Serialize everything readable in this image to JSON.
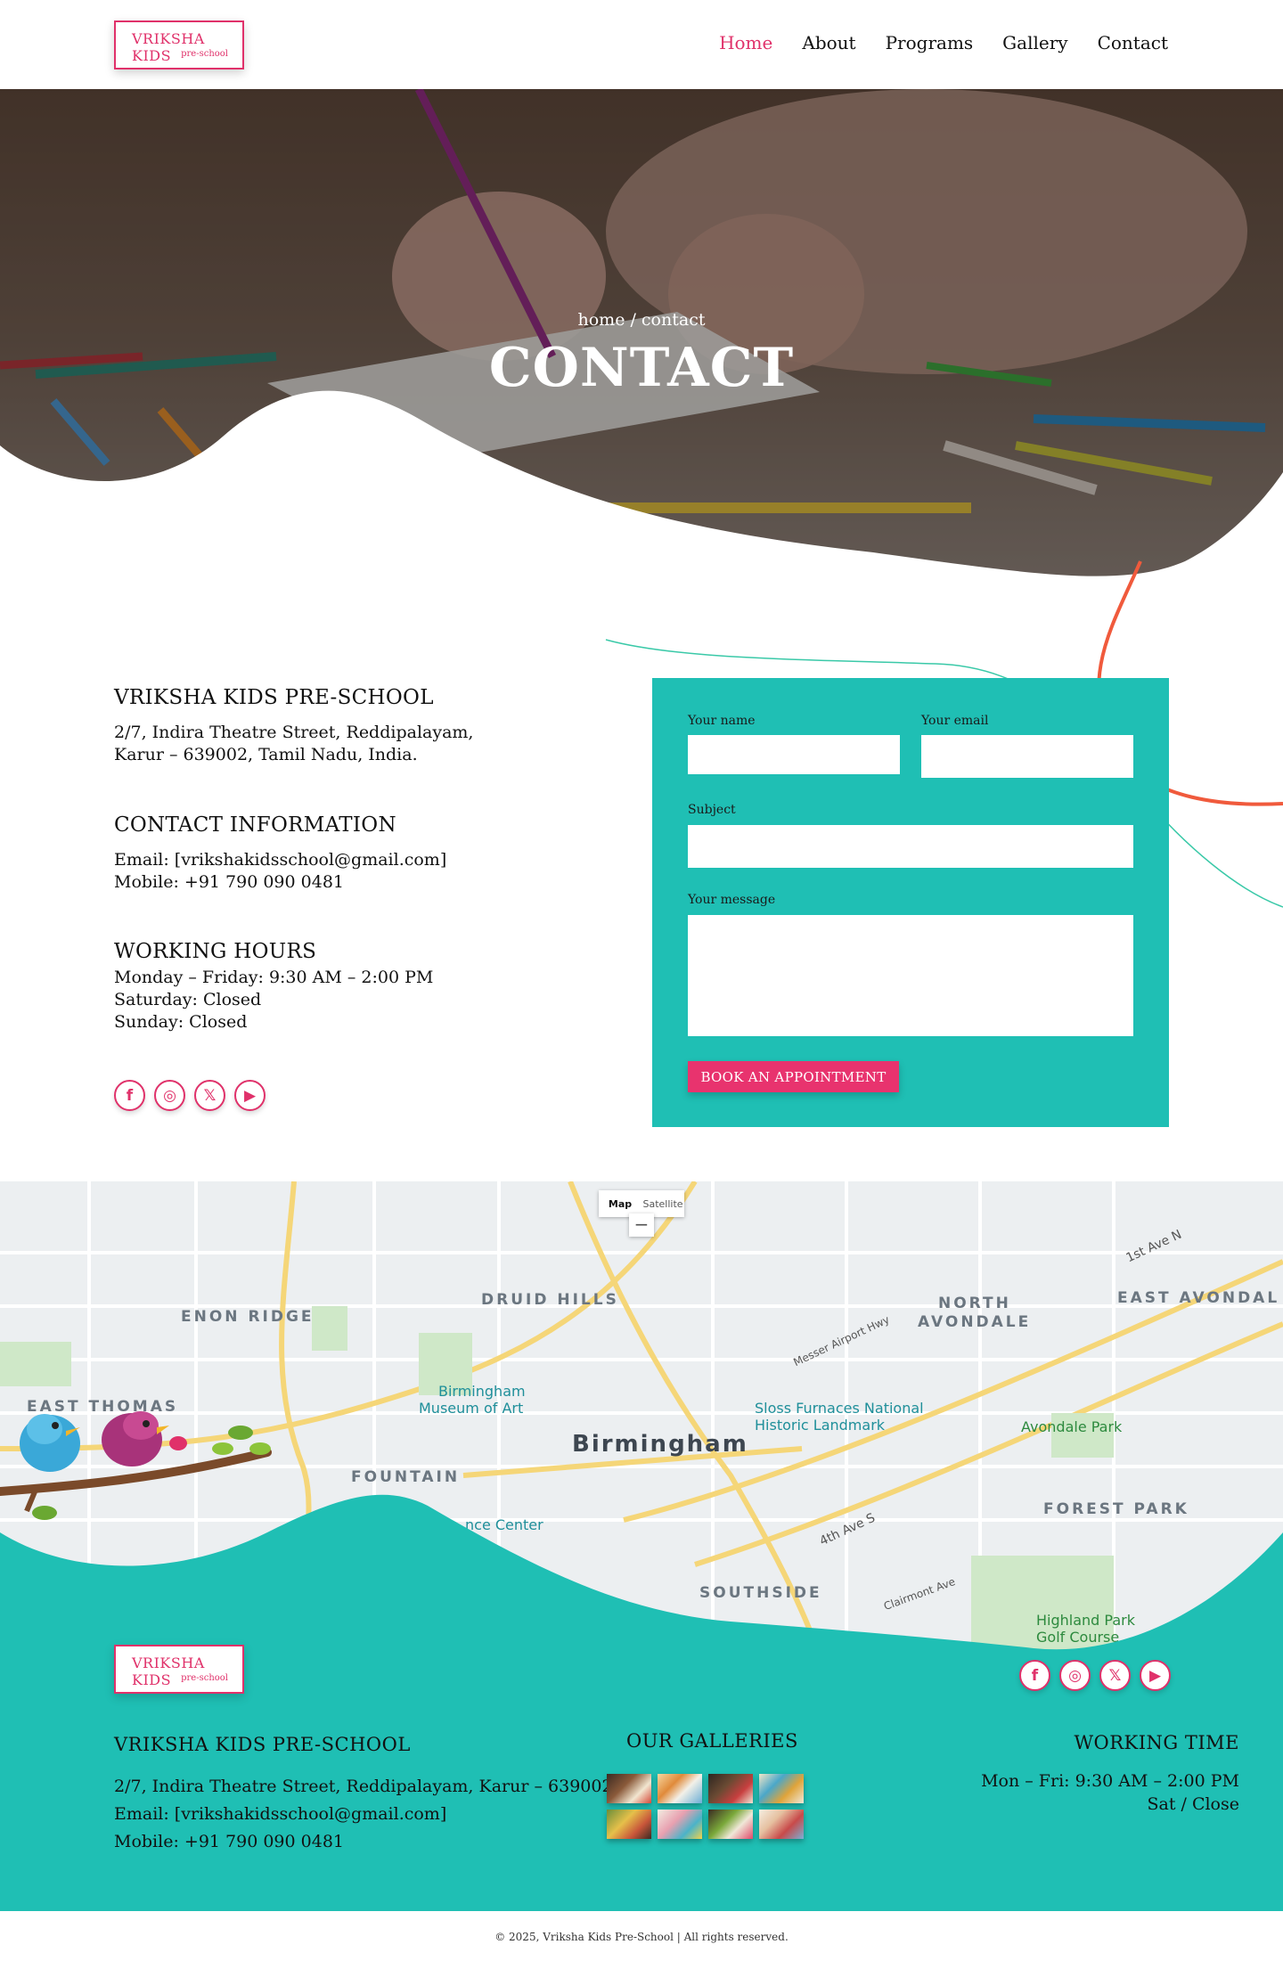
{
  "header": {
    "logo": {
      "line1": "VRIKSHA KIDS",
      "line2": "pre-school"
    },
    "nav": [
      {
        "label": "Home",
        "active": true
      },
      {
        "label": "About"
      },
      {
        "label": "Programs"
      },
      {
        "label": "Gallery"
      },
      {
        "label": "Contact"
      }
    ]
  },
  "hero": {
    "breadcrumb": "home / contact",
    "title": "CONTACT"
  },
  "contact": {
    "school": {
      "title": "VRIKSHA KIDS PRE-SCHOOL",
      "address_line1": "2/7, Indira Theatre Street, Reddipalayam,",
      "address_line2": " Karur – 639002, Tamil Nadu, India."
    },
    "info": {
      "title": "CONTACT INFORMATION",
      "email": "Email: [vrikshakidsschool@gmail.com]",
      "mobile": " Mobile: +91 790 090 0481"
    },
    "hours": {
      "title": "WORKING HOURS",
      "weekdays": "Monday – Friday: 9:30 AM – 2:00 PM",
      "saturday": " Saturday: Closed",
      "sunday": " Sunday: Closed"
    },
    "social": [
      {
        "icon": "facebook-icon",
        "glyph": "f"
      },
      {
        "icon": "instagram-icon",
        "glyph": "◎"
      },
      {
        "icon": "x-twitter-icon",
        "glyph": "𝕏"
      },
      {
        "icon": "youtube-icon",
        "glyph": "▶"
      }
    ]
  },
  "form": {
    "name_label": "Your name",
    "email_label": "Your email",
    "subject_label": "Subject",
    "message_label": "Your message",
    "button_label": "BOOK AN APPOINTMENT"
  },
  "map": {
    "toggle_map": "Map",
    "toggle_satellite": "Satellite",
    "zoom_out": "−",
    "labels": {
      "enon_ridge": "ENON RIDGE",
      "druid_hills": "DRUID HILLS",
      "north_avondale_1": "NORTH",
      "north_avondale_2": "AVONDALE",
      "east_avondale": "EAST AVONDAL",
      "east_thomas": "EAST THOMAS",
      "fountain": "FOUNTAIN",
      "birmingham": "Birmingham",
      "forest_park": "FOREST PARK",
      "southside": "SOUTHSIDE",
      "museum_1": "Birmingham",
      "museum_2": "Museum of Art",
      "sloss_1": "Sloss Furnaces National",
      "sloss_2": "Historic Landmark",
      "avondale_park": "Avondale Park",
      "highland_1": "Highland Park",
      "highland_2": "Golf Course",
      "center": "nce Center",
      "first_ave": "1st Ave N",
      "fourth_ave": "4th Ave S",
      "messer": "Messer Airport Hwy",
      "clairmont": "Clairmont Ave"
    }
  },
  "footer": {
    "logo": {
      "line1": "VRIKSHA KIDS",
      "line2": "pre-school"
    },
    "school_title": "VRIKSHA KIDS PRE-SCHOOL",
    "address": "2/7, Indira Theatre Street, Reddipalayam, Karur – 639002",
    "email": " Email: [vrikshakidsschool@gmail.com]",
    "mobile": "Mobile: +91 790 090 0481",
    "galleries_title": "OUR GALLERIES",
    "working_title": "WORKING TIME",
    "working_weekdays": "Mon – Fri: 9:30 AM – 2:00 PM",
    "working_sat": "Sat / Close",
    "copyright": "© 2025, Vriksha Kids Pre-School | All rights reserved."
  },
  "colors": {
    "accent_pink": "#e0316a",
    "teal": "#1fbfb4",
    "orange_line": "#f05a3c"
  }
}
